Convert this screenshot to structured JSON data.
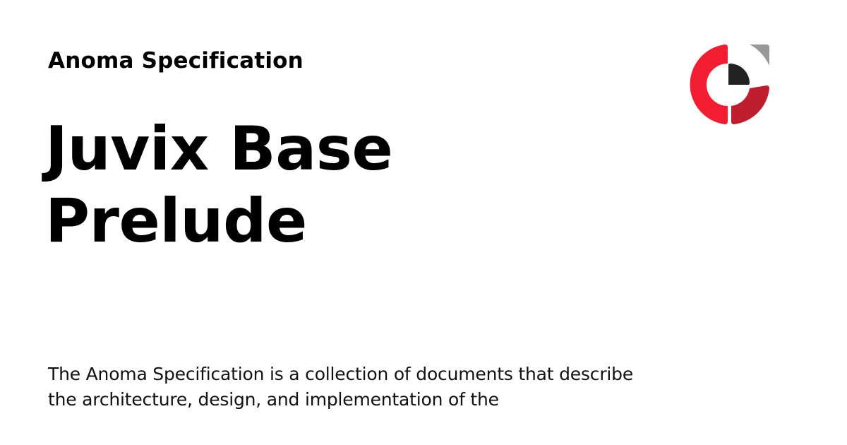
{
  "site_name": "Anoma Specification",
  "page_title": "Juvix Base Prelude",
  "description": "The Anoma Specification is a collection of documents that describe the architecture, design, and implementation of the",
  "logo": {
    "icon": "anoma-logo",
    "colors": {
      "red": "#f21d30",
      "dark_red": "#be1e2d",
      "black": "#222222",
      "gray": "#999999"
    }
  }
}
